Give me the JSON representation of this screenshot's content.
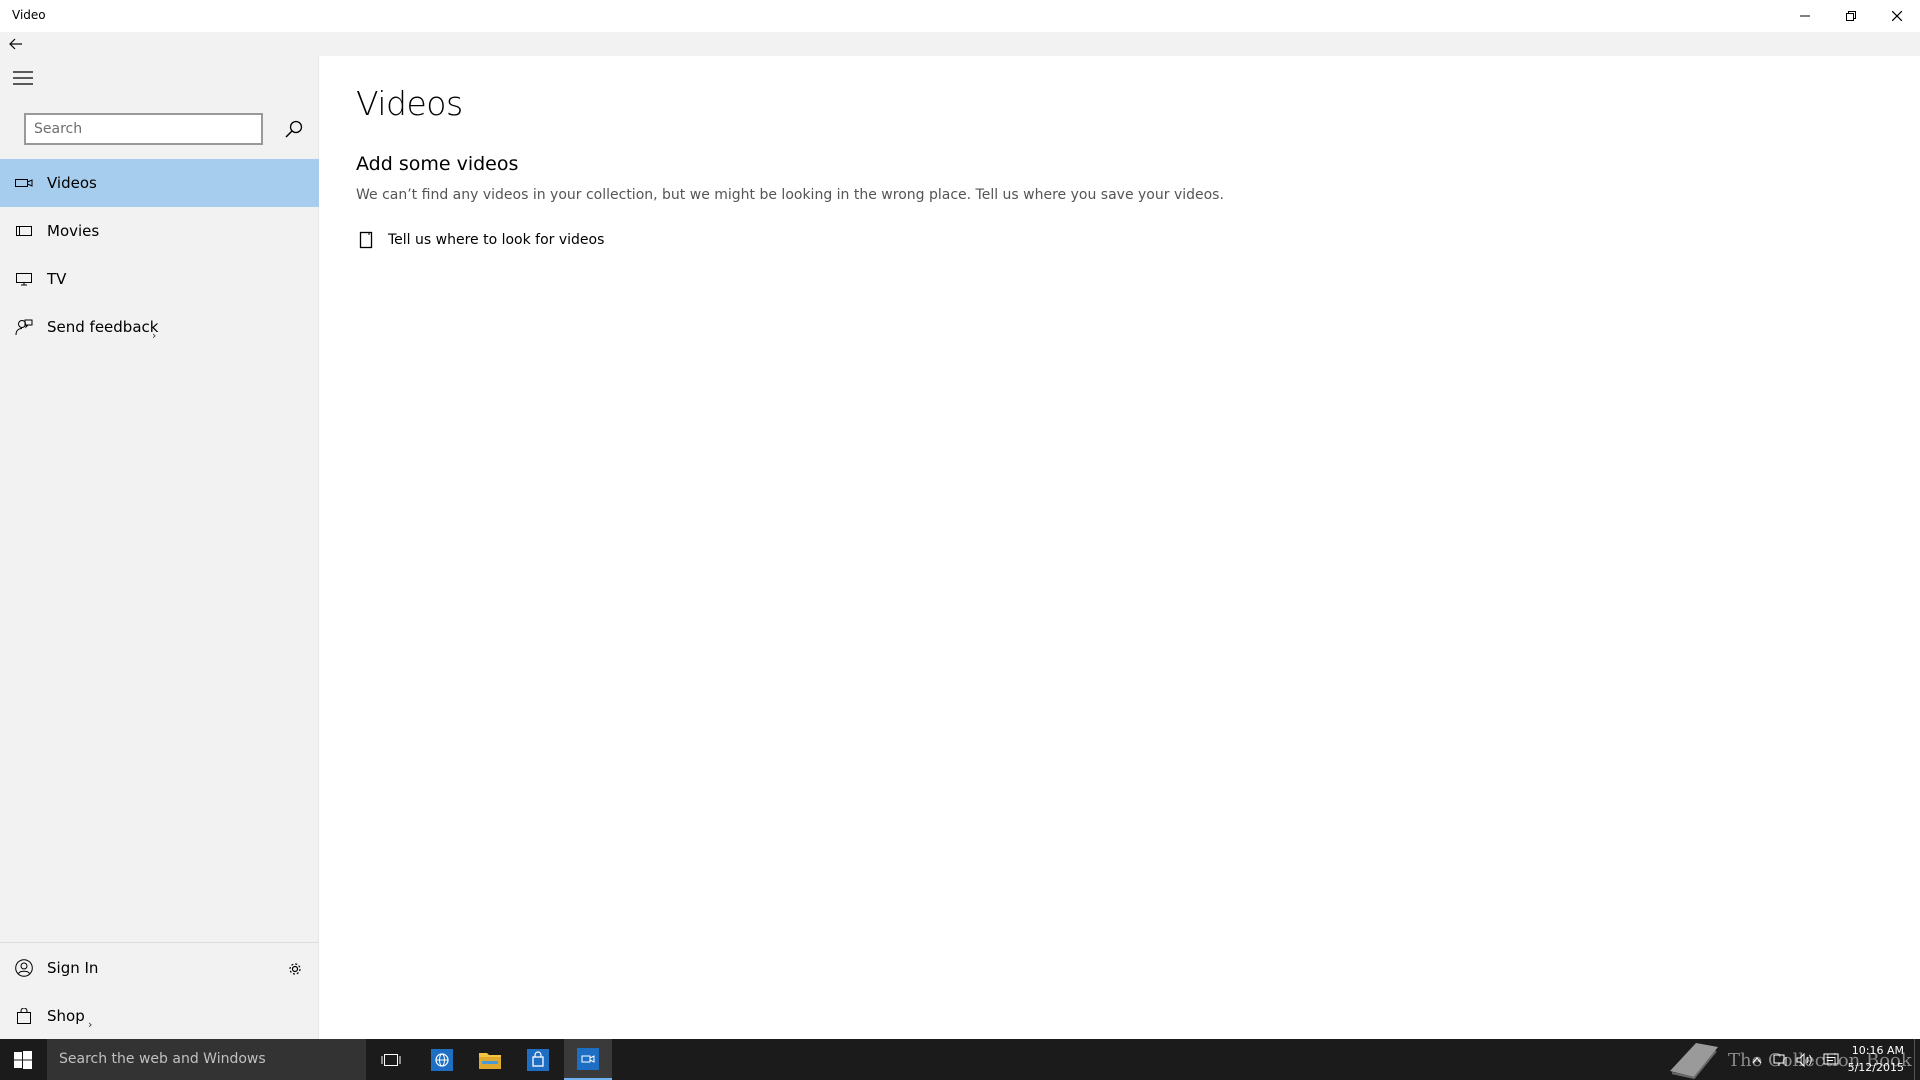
{
  "window": {
    "title": "Video"
  },
  "sidebar": {
    "search_placeholder": "Search",
    "items": [
      {
        "label": "Videos",
        "icon": "video-icon",
        "selected": true
      },
      {
        "label": "Movies",
        "icon": "film-icon",
        "selected": false
      },
      {
        "label": "TV",
        "icon": "tv-icon",
        "selected": false
      },
      {
        "label": "Send feedback",
        "icon": "feedback-icon",
        "selected": false,
        "chevron": true
      }
    ],
    "bottom": {
      "sign_in": "Sign In",
      "shop": "Shop"
    }
  },
  "main": {
    "title": "Videos",
    "subtitle": "Add some videos",
    "description": "We can’t find any videos in your collection, but we might be looking in the wrong place. Tell us where you save your videos.",
    "link_label": "Tell us where to look for videos"
  },
  "taskbar": {
    "search_text": "Search the web and Windows",
    "watermark_text": "The Collection Book",
    "time": "10:16 AM",
    "date": "5/12/2015"
  },
  "colors": {
    "accent": "#a7cdee",
    "sidebar_bg": "#f2f2f2",
    "taskbar_bg": "#1b1b1b"
  }
}
